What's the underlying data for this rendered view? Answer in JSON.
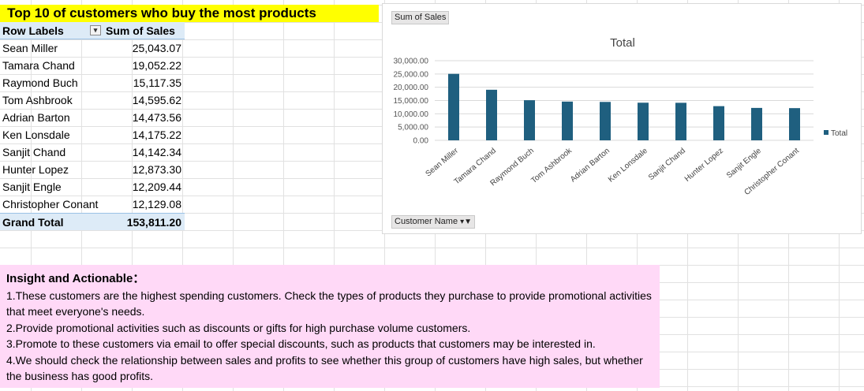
{
  "title": "Top 10 of customers who buy the most products",
  "pivot": {
    "headers": {
      "row_labels": "Row Labels",
      "sum_of_sales": "Sum of Sales"
    },
    "rows": [
      {
        "name": "Sean Miller",
        "value": "25,043.07"
      },
      {
        "name": "Tamara Chand",
        "value": "19,052.22"
      },
      {
        "name": "Raymond Buch",
        "value": "15,117.35"
      },
      {
        "name": "Tom Ashbrook",
        "value": "14,595.62"
      },
      {
        "name": "Adrian Barton",
        "value": "14,473.56"
      },
      {
        "name": "Ken Lonsdale",
        "value": "14,175.22"
      },
      {
        "name": "Sanjit Chand",
        "value": "14,142.34"
      },
      {
        "name": "Hunter Lopez",
        "value": "12,873.30"
      },
      {
        "name": "Sanjit Engle",
        "value": "12,209.44"
      },
      {
        "name": "Christopher Conant",
        "value": "12,129.08"
      }
    ],
    "grand_total": {
      "label": "Grand Total",
      "value": "153,811.20"
    }
  },
  "chart_buttons": {
    "value_field": "Sum of Sales",
    "axis_field": "Customer Name"
  },
  "colors": {
    "bar": "#1f5f7f",
    "title_bg": "#ffff00",
    "pivot_header": "#ddebf7",
    "insight_bg": "#ffd9f7"
  },
  "chart_data": {
    "type": "bar",
    "title": "Total",
    "categories": [
      "Sean Miller",
      "Tamara Chand",
      "Raymond Buch",
      "Tom Ashbrook",
      "Adrian Barton",
      "Ken Lonsdale",
      "Sanjit Chand",
      "Hunter Lopez",
      "Sanjit Engle",
      "Christopher Conant"
    ],
    "series": [
      {
        "name": "Total",
        "values": [
          25043.07,
          19052.22,
          15117.35,
          14595.62,
          14473.56,
          14175.22,
          14142.34,
          12873.3,
          12209.44,
          12129.08
        ]
      }
    ],
    "ylim": [
      0,
      30000
    ],
    "yticks": [
      "0.00",
      "5,000.00",
      "10,000.00",
      "15,000.00",
      "20,000.00",
      "25,000.00",
      "30,000.00"
    ],
    "grid": true,
    "legend": "right"
  },
  "insight": {
    "heading": "Insight and Actionable：",
    "lines": [
      "1.These customers are the highest spending customers. Check the types of products they purchase to provide promotional activities that meet everyone's needs.",
      "2.Provide promotional activities such as discounts or gifts for high purchase volume customers.",
      "3.Promote to these customers via email to offer special discounts, such as products that customers may be interested in.",
      "4.We should check the relationship between sales and profits to see whether this group of customers have high sales, but whether the business has good profits."
    ]
  }
}
